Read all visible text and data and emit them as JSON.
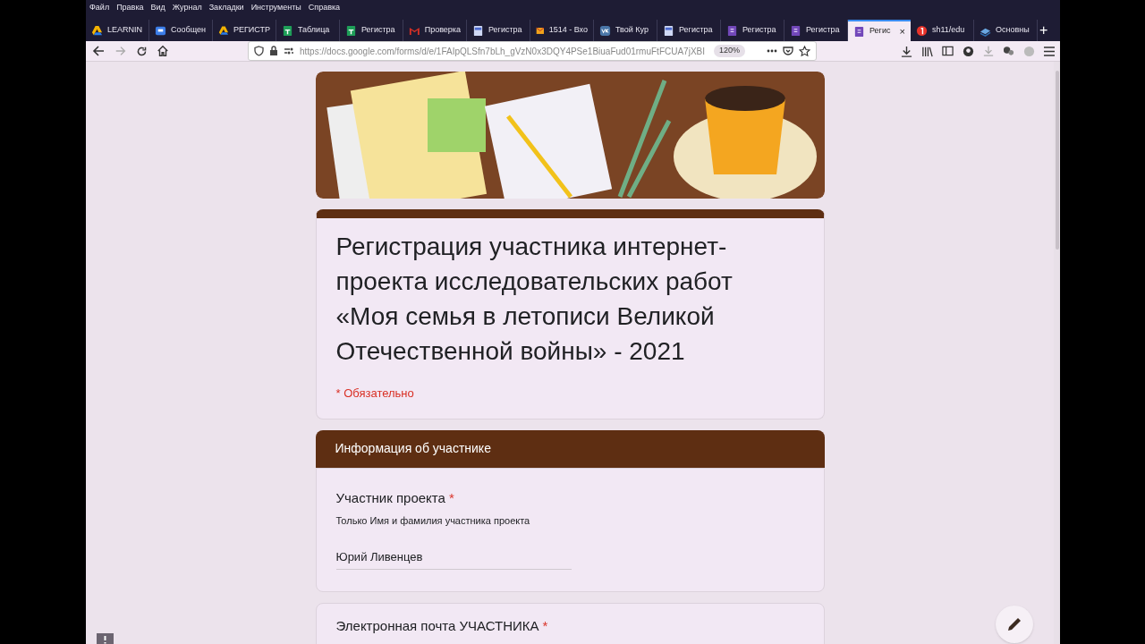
{
  "menu_bar": [
    "Файл",
    "Правка",
    "Вид",
    "Журнал",
    "Закладки",
    "Инструменты",
    "Справка"
  ],
  "tabs": [
    {
      "label": "LEARNIN",
      "kind": "drive",
      "selected": false
    },
    {
      "label": "Сообщен",
      "kind": "chat",
      "selected": false
    },
    {
      "label": "РЕГИСТР",
      "kind": "drive",
      "selected": false
    },
    {
      "label": "Таблица",
      "kind": "sheets",
      "selected": false
    },
    {
      "label": "Регистра",
      "kind": "sheets",
      "selected": false
    },
    {
      "label": "Проверка",
      "kind": "gmail",
      "selected": false
    },
    {
      "label": "Регистра",
      "kind": "docs",
      "selected": false
    },
    {
      "label": "1514 - Вхо",
      "kind": "mail",
      "selected": false
    },
    {
      "label": "Твой Кур",
      "kind": "vk",
      "selected": false
    },
    {
      "label": "Регистра",
      "kind": "docs",
      "selected": false
    },
    {
      "label": "Регистра",
      "kind": "forms",
      "selected": false
    },
    {
      "label": "Регистра",
      "kind": "forms",
      "selected": false
    },
    {
      "label": "Регис",
      "kind": "forms",
      "selected": true,
      "close": "×"
    },
    {
      "label": "sh11/edu",
      "kind": "yandex",
      "selected": false
    },
    {
      "label": "Основны",
      "kind": "book",
      "selected": false
    }
  ],
  "new_tab_button": "+",
  "address_bar": {
    "url": "https://docs.google.com/forms/d/e/1FAIpQLSfn7bLh_gVzN0x3DQY4PSe1BiuaFud01rmuFtFCUA7jXBI",
    "zoom": "120%"
  },
  "form": {
    "title": "Регистрация участника интернет-проекта исследовательских работ «Моя семья в летописи Великой Отечественной войны» - 2021",
    "required_note": "* Обязательно",
    "section_title": "Информация об участнике",
    "questions": [
      {
        "label": "Участник проекта",
        "required_mark": "*",
        "hint": "Только Имя и фамилия участника проекта",
        "value": "Юрий Ливенцев"
      },
      {
        "label": "Электронная почта УЧАСТНИКА",
        "required_mark": "*"
      }
    ]
  }
}
